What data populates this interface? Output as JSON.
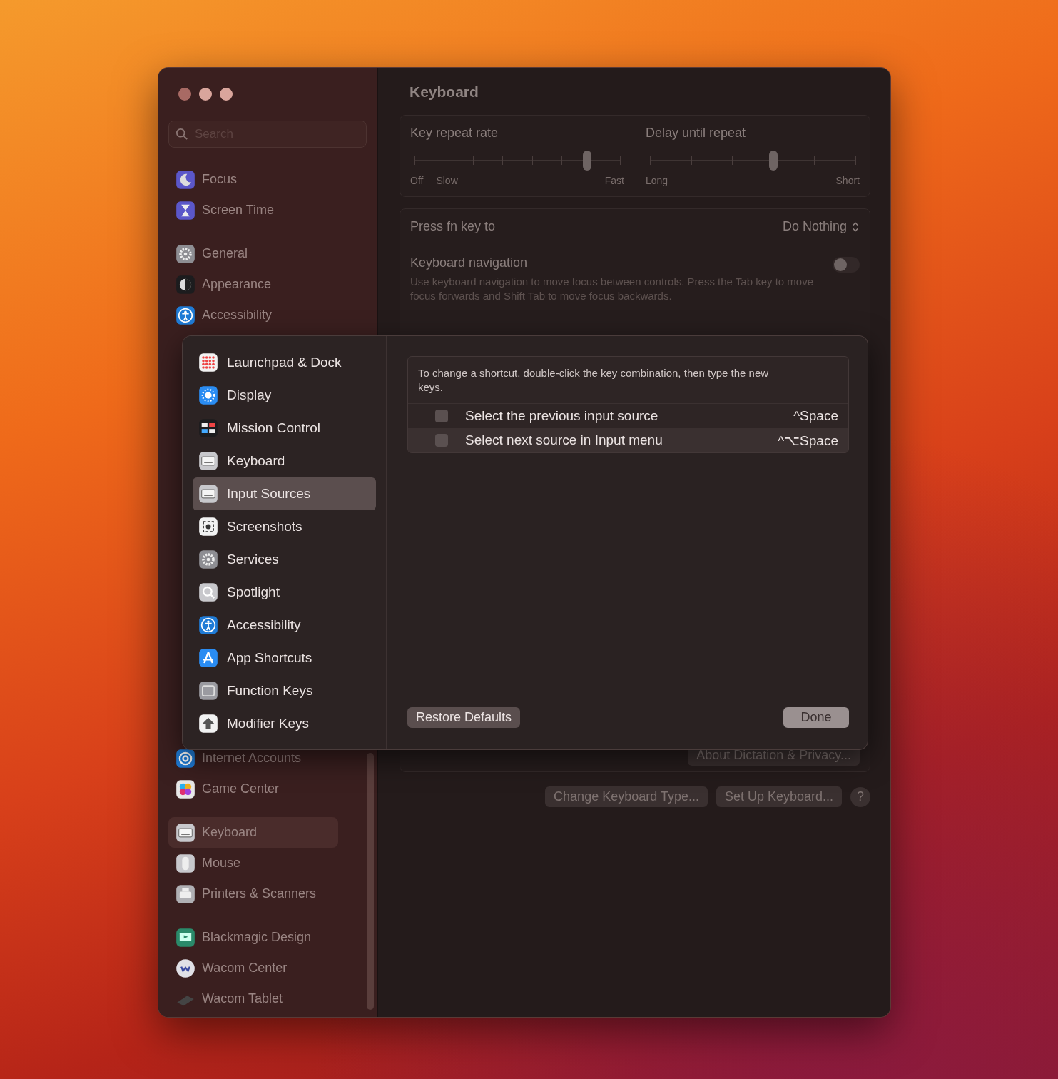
{
  "sidebar": {
    "search": {
      "placeholder": "Search"
    },
    "groups": [
      [
        {
          "label": "Focus",
          "kind": "moon",
          "selected": false
        },
        {
          "label": "Screen Time",
          "kind": "hourglass",
          "selected": false
        }
      ],
      [
        {
          "label": "General",
          "kind": "gear",
          "selected": false
        },
        {
          "label": "Appearance",
          "kind": "contrast",
          "selected": false
        },
        {
          "label": "Accessibility",
          "kind": "person",
          "selected": false
        }
      ],
      [
        {
          "label": "Internet Accounts",
          "kind": "at",
          "selected": false
        },
        {
          "label": "Game Center",
          "kind": "bubbles",
          "selected": false
        }
      ],
      [
        {
          "label": "Keyboard",
          "kind": "keyboard",
          "selected": true
        },
        {
          "label": "Mouse",
          "kind": "mouse",
          "selected": false
        },
        {
          "label": "Printers & Scanners",
          "kind": "printer",
          "selected": false
        }
      ],
      [
        {
          "label": "Blackmagic Design",
          "kind": "monitor",
          "selected": false
        },
        {
          "label": "Wacom Center",
          "kind": "badge",
          "selected": false
        },
        {
          "label": "Wacom Tablet",
          "kind": "tablet",
          "selected": false
        }
      ]
    ]
  },
  "main": {
    "title": "Keyboard",
    "sliders": [
      {
        "label": "Key repeat rate",
        "level": 0.84,
        "marks": [
          "Off",
          "Slow",
          "Fast"
        ]
      },
      {
        "label": "Delay until repeat",
        "level": 0.6,
        "marks": [
          "Long",
          "Short"
        ]
      }
    ],
    "fn_row": {
      "label": "Press fn key to",
      "value": "Do Nothing"
    },
    "keyboard_navigation": {
      "label": "Keyboard navigation",
      "on": false,
      "description": "Use keyboard navigation to move focus between controls. Press the Tab key to move focus forwards and Shift Tab to move focus backwards."
    },
    "dictation_button": "About Dictation & Privacy...",
    "buttons": [
      "Change Keyboard Type...",
      "Set Up Keyboard..."
    ],
    "help": "?"
  },
  "sheet": {
    "items": [
      {
        "label": "Launchpad & Dock",
        "kind": "grid",
        "selected": false
      },
      {
        "label": "Display",
        "kind": "sun",
        "selected": false
      },
      {
        "label": "Mission Control",
        "kind": "windows",
        "selected": false
      },
      {
        "label": "Keyboard",
        "kind": "keyboard",
        "selected": false
      },
      {
        "label": "Input Sources",
        "kind": "keyboard",
        "selected": true
      },
      {
        "label": "Screenshots",
        "kind": "camera",
        "selected": false
      },
      {
        "label": "Services",
        "kind": "gear",
        "selected": false
      },
      {
        "label": "Spotlight",
        "kind": "search",
        "selected": false
      },
      {
        "label": "Accessibility",
        "kind": "person",
        "selected": false
      },
      {
        "label": "App Shortcuts",
        "kind": "appstore",
        "selected": false
      },
      {
        "label": "Function Keys",
        "kind": "key",
        "selected": false
      },
      {
        "label": "Modifier Keys",
        "kind": "arrowup",
        "selected": false
      }
    ],
    "note": "To change a shortcut, double-click the key combination, then type the new keys.",
    "shortcuts": [
      {
        "label": "Select the previous input source",
        "keys": "^Space",
        "checked": false
      },
      {
        "label": "Select next source in Input menu",
        "keys": "^⌥Space",
        "checked": false
      }
    ],
    "buttons": {
      "restore": "Restore Defaults",
      "done": "Done"
    }
  }
}
